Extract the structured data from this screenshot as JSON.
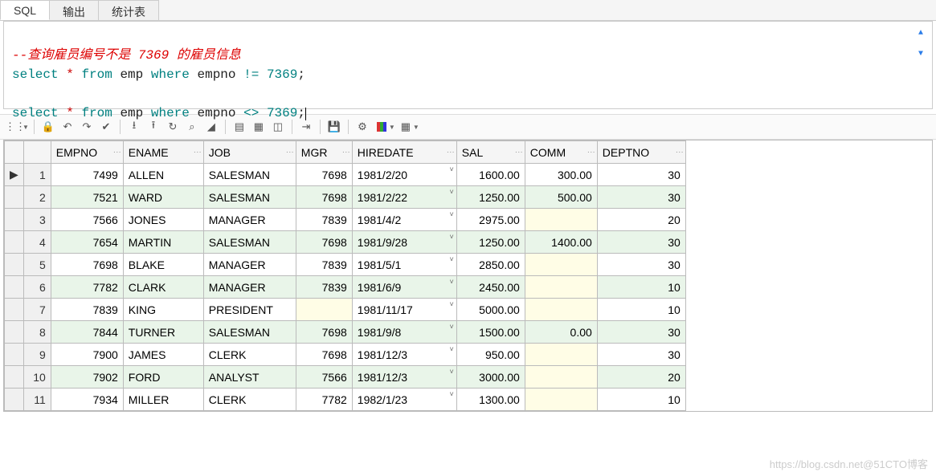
{
  "tabs": [
    {
      "label": "SQL",
      "active": true
    },
    {
      "label": "输出",
      "active": false
    },
    {
      "label": "统计表",
      "active": false
    }
  ],
  "sql": {
    "comment": "--查询雇员编号不是 7369 的雇员信息",
    "q1": {
      "k1": "select",
      "star": "*",
      "k2": "from",
      "tbl": "emp",
      "k3": "where",
      "col": "empno",
      "op": "!=",
      "val": "7369",
      "semi": ";"
    },
    "q2": {
      "k1": "select",
      "star": "*",
      "k2": "from",
      "tbl": "emp",
      "k3": "where",
      "col": "empno",
      "op": "<>",
      "val": "7369",
      "semi": ";"
    }
  },
  "toolbar_icons": {
    "grip": "⋮⋮",
    "lock": "🔒",
    "undo1": "↶",
    "redo1": "↷",
    "check": "✔",
    "collapse": "⭳",
    "expand": "⭱",
    "refresh": "↻",
    "find": "⌕",
    "eraser": "◢",
    "image": "▤",
    "boxed": "▦",
    "tree": "◫",
    "export": "⇥",
    "save": "💾",
    "bug": "⚙",
    "chart": "",
    "grid": "▦"
  },
  "table": {
    "columns": [
      "EMPNO",
      "ENAME",
      "JOB",
      "MGR",
      "HIREDATE",
      "SAL",
      "COMM",
      "DEPTNO"
    ],
    "rows": [
      {
        "n": "1",
        "marker": "▶",
        "empno": "7499",
        "ename": "ALLEN",
        "job": "SALESMAN",
        "mgr": "7698",
        "hiredate": "1981/2/20",
        "sal": "1600.00",
        "comm": "300.00",
        "deptno": "30"
      },
      {
        "n": "2",
        "marker": "",
        "empno": "7521",
        "ename": "WARD",
        "job": "SALESMAN",
        "mgr": "7698",
        "hiredate": "1981/2/22",
        "sal": "1250.00",
        "comm": "500.00",
        "deptno": "30"
      },
      {
        "n": "3",
        "marker": "",
        "empno": "7566",
        "ename": "JONES",
        "job": "MANAGER",
        "mgr": "7839",
        "hiredate": "1981/4/2",
        "sal": "2975.00",
        "comm": "",
        "deptno": "20"
      },
      {
        "n": "4",
        "marker": "",
        "empno": "7654",
        "ename": "MARTIN",
        "job": "SALESMAN",
        "mgr": "7698",
        "hiredate": "1981/9/28",
        "sal": "1250.00",
        "comm": "1400.00",
        "deptno": "30"
      },
      {
        "n": "5",
        "marker": "",
        "empno": "7698",
        "ename": "BLAKE",
        "job": "MANAGER",
        "mgr": "7839",
        "hiredate": "1981/5/1",
        "sal": "2850.00",
        "comm": "",
        "deptno": "30"
      },
      {
        "n": "6",
        "marker": "",
        "empno": "7782",
        "ename": "CLARK",
        "job": "MANAGER",
        "mgr": "7839",
        "hiredate": "1981/6/9",
        "sal": "2450.00",
        "comm": "",
        "deptno": "10"
      },
      {
        "n": "7",
        "marker": "",
        "empno": "7839",
        "ename": "KING",
        "job": "PRESIDENT",
        "mgr": "",
        "hiredate": "1981/11/17",
        "sal": "5000.00",
        "comm": "",
        "deptno": "10"
      },
      {
        "n": "8",
        "marker": "",
        "empno": "7844",
        "ename": "TURNER",
        "job": "SALESMAN",
        "mgr": "7698",
        "hiredate": "1981/9/8",
        "sal": "1500.00",
        "comm": "0.00",
        "deptno": "30"
      },
      {
        "n": "9",
        "marker": "",
        "empno": "7900",
        "ename": "JAMES",
        "job": "CLERK",
        "mgr": "7698",
        "hiredate": "1981/12/3",
        "sal": "950.00",
        "comm": "",
        "deptno": "30"
      },
      {
        "n": "10",
        "marker": "",
        "empno": "7902",
        "ename": "FORD",
        "job": "ANALYST",
        "mgr": "7566",
        "hiredate": "1981/12/3",
        "sal": "3000.00",
        "comm": "",
        "deptno": "20"
      },
      {
        "n": "11",
        "marker": "",
        "empno": "7934",
        "ename": "MILLER",
        "job": "CLERK",
        "mgr": "7782",
        "hiredate": "1982/1/23",
        "sal": "1300.00",
        "comm": "",
        "deptno": "10"
      }
    ]
  },
  "watermark": "https://blog.csdn.net@51CTO博客"
}
